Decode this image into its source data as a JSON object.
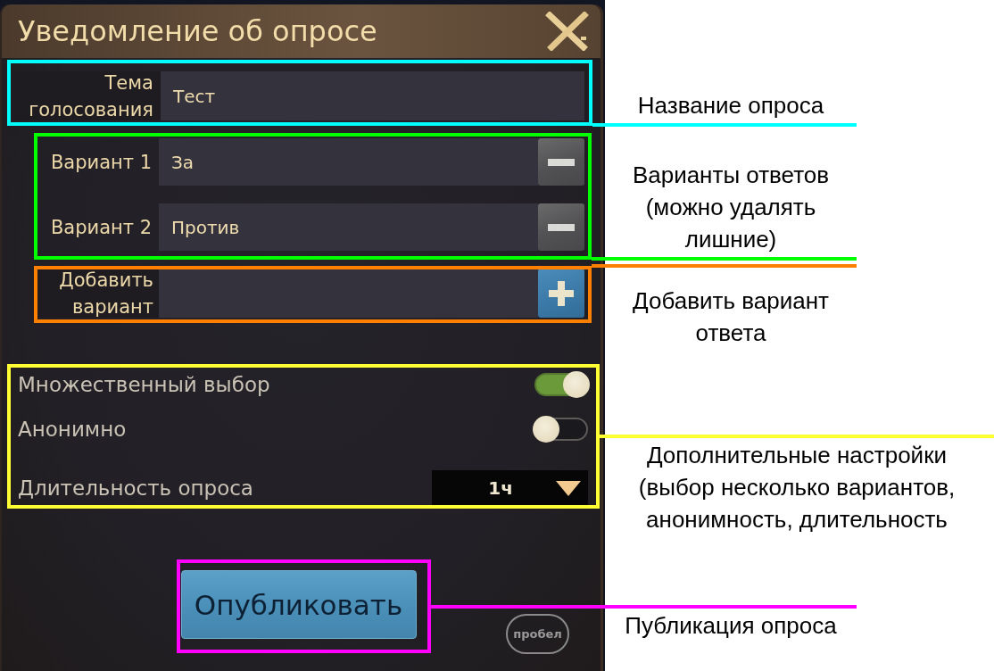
{
  "dialog": {
    "title": "Уведомление об опросе",
    "topic": {
      "label": "Тема голосования",
      "value": "Тест"
    },
    "options": [
      {
        "label": "Вариант 1",
        "value": "За"
      },
      {
        "label": "Вариант 2",
        "value": "Против"
      }
    ],
    "add_option": {
      "label": "Добавить вариант"
    },
    "settings": [
      {
        "kind": "toggle",
        "label": "Множественный выбор",
        "on": true
      },
      {
        "kind": "toggle",
        "label": "Анонимно",
        "on": false
      },
      {
        "kind": "dropdown",
        "label": "Длительность опроса",
        "value": "1ч"
      }
    ],
    "publish_button": "Опубликовать",
    "key_hint": "пробел"
  },
  "annotations": [
    {
      "label": "Название опроса",
      "color": "#00ffff"
    },
    {
      "label": "Варианты ответов (можно удалять лишние)",
      "color": "#00ff00"
    },
    {
      "label": "Добавить вариант ответа",
      "color": "#ff8000"
    },
    {
      "label": "Дополнительные настройки (выбор несколько вариантов, анонимность, длительность",
      "color": "#ffff33"
    },
    {
      "label": "Публикация опроса",
      "color": "#ff00ff"
    }
  ]
}
